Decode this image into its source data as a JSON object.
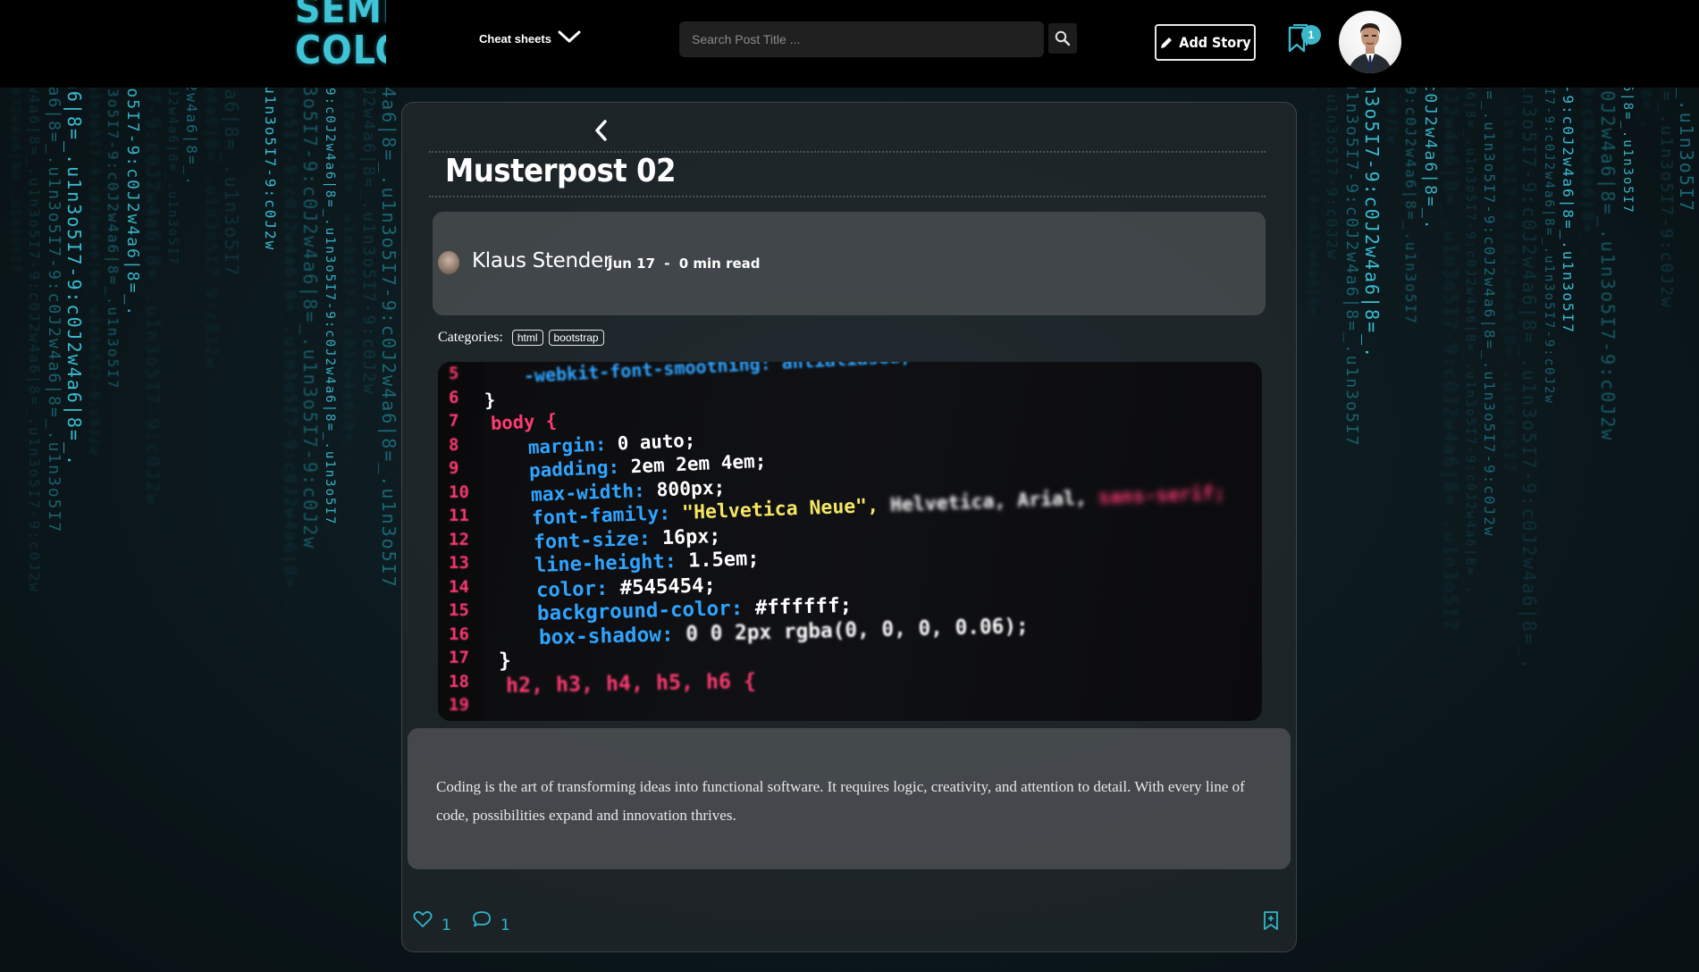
{
  "header": {
    "logo_line1": "SEMI",
    "logo_line2": "COLONS",
    "cheat_sheets_label": "Cheat sheets",
    "search_placeholder": "Search Post Title ...",
    "add_story_label": "Add Story",
    "bookmark_count": "1"
  },
  "post": {
    "title": "Musterpost 02",
    "author": "Klaus Stender",
    "date": "Jun 17",
    "separator": "-",
    "read_time": "0 min read",
    "categories_label": "Categories:",
    "categories": [
      "html",
      "bootstrap"
    ],
    "body": "Coding is the art of transforming ideas into functional software. It requires logic, creativity, and attention to detail. With every line of code, possibilities expand and innovation thrives.",
    "likes": "1",
    "comments": "1"
  },
  "hero_code": {
    "line_numbers": [
      "5",
      "6",
      "7",
      "8",
      "9",
      "10",
      "11",
      "12",
      "13",
      "14",
      "15",
      "16",
      "17",
      "18",
      "19"
    ],
    "lines": [
      "-webkit-font-smoothing: antialiased;",
      "}",
      "body {",
      "margin: 0 auto;",
      "padding: 2em 2em 4em;",
      "max-width: 800px;",
      "font-family: \"Helvetica Neue\", Helvetica, Arial, sans-serif;",
      "font-size: 16px;",
      "line-height: 1.5em;",
      "color: #545454;",
      "background-color: #ffffff;",
      "box-shadow: 0 0 2px rgba(0, 0, 0, 0.06);",
      "}",
      "h2, h3, h4, h5, h6 {"
    ]
  },
  "colors": {
    "accent": "#3ab7c8",
    "header_bg": "#000000",
    "card_bg": "#2b2f31"
  },
  "icons": [
    "chevron-down-icon",
    "search-icon",
    "pencil-icon",
    "bookmark-icon",
    "back-arrow-icon",
    "heart-icon",
    "comment-icon",
    "bookmark-add-icon"
  ]
}
